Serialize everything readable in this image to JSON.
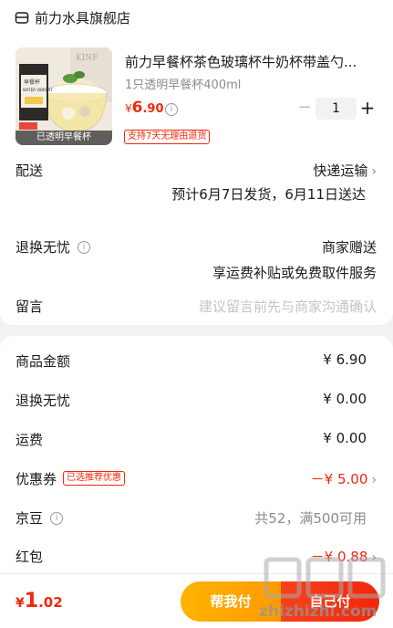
{
  "store": {
    "name": "前力水具旗舰店",
    "icon": "store-icon"
  },
  "product": {
    "title": "前力早餐杯茶色玻璃杯牛奶杯带盖勺...",
    "spec": "1只透明早餐杯400ml",
    "price_symbol": "¥",
    "price_int": "6",
    "price_dec": ".90",
    "quantity": "1",
    "return_tag": "支持7天无理由退货",
    "thumb_caption": "已透明早餐杯",
    "thumb_brand": "KINF",
    "thumb_box_lines": [
      "早餐杯",
      "WATER VIBRANT"
    ]
  },
  "delivery": {
    "label": "配送",
    "method": "快递运输",
    "estimate": "预计6月7日发货，6月11日送达"
  },
  "worry_free": {
    "label": "退换无忧",
    "value": "商家赠送",
    "desc": "享运费补贴或免费取件服务"
  },
  "message": {
    "label": "留言",
    "placeholder": "建议留言前先与商家沟通确认"
  },
  "summary": {
    "goods": {
      "label": "商品金额",
      "value": "¥ 6.90"
    },
    "worry_free": {
      "label": "退换无忧",
      "value": "¥ 0.00"
    },
    "shipping": {
      "label": "运费",
      "value": "¥ 0.00"
    },
    "coupon": {
      "label": "优惠券",
      "tag": "已选推荐优惠",
      "value": "－¥ 5.00"
    },
    "jd_beans": {
      "label": "京豆",
      "value": "共52，满500可用"
    },
    "red_packet": {
      "label": "红包",
      "value": "－¥ 0.88"
    }
  },
  "footer": {
    "total_symbol": "¥",
    "total_int": "1",
    "total_dec": ".02",
    "help_pay": "帮我付",
    "self_pay": "自己付"
  },
  "watermark": {
    "text": "zhizhizhi.com"
  },
  "colors": {
    "accent": "#f2270c",
    "help": "#ffa600",
    "gray": "#8c8c8c"
  }
}
